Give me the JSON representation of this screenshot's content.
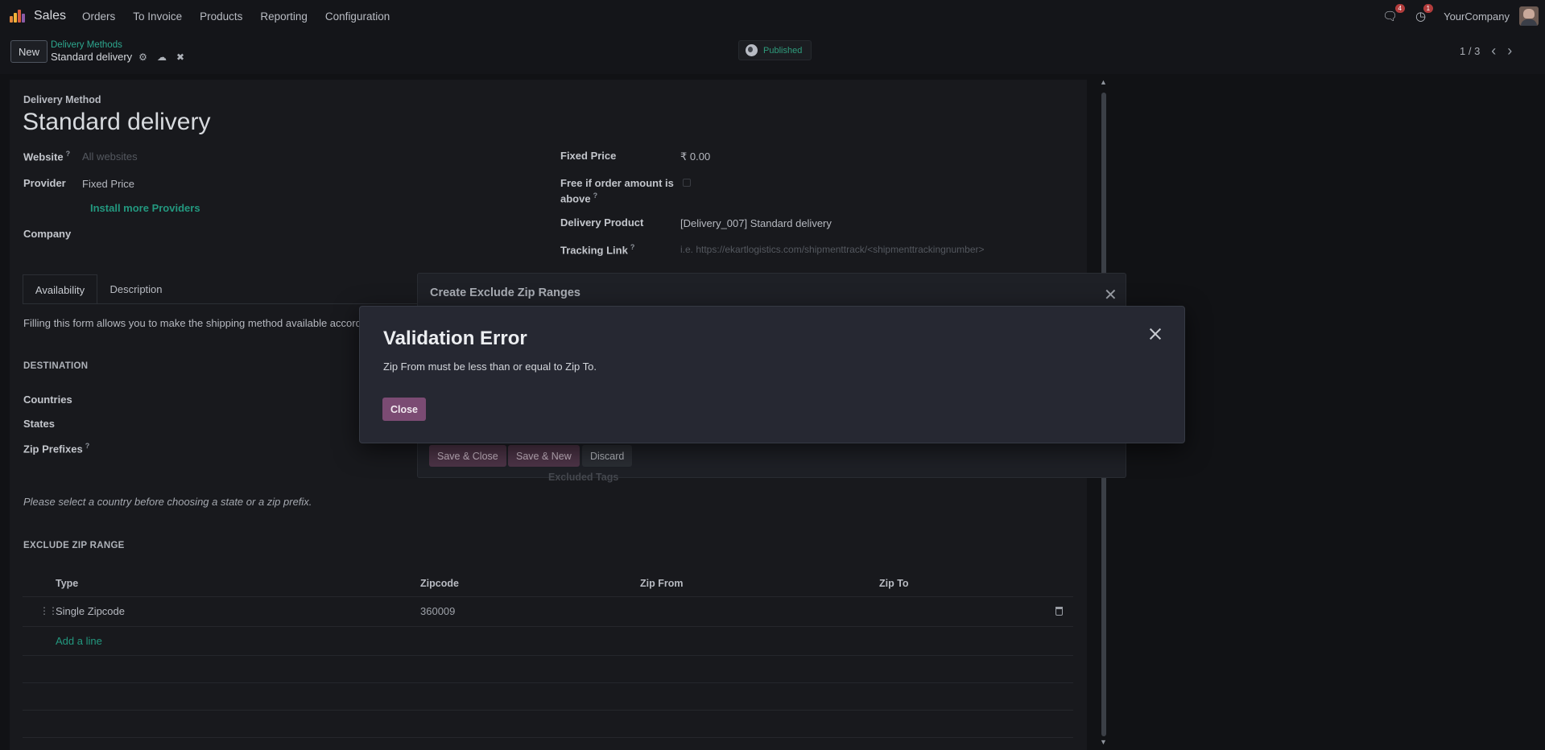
{
  "navbar": {
    "app_name": "Sales",
    "menu": [
      "Orders",
      "To Invoice",
      "Products",
      "Reporting",
      "Configuration"
    ],
    "messages_badge": "4",
    "activities_badge": "1",
    "company": "YourCompany"
  },
  "control": {
    "new_label": "New",
    "breadcrumb_parent": "Delivery Methods",
    "breadcrumb_current": "Standard delivery",
    "published_label": "Published",
    "pager": "1 / 3"
  },
  "form": {
    "header_label": "Delivery Method",
    "name": "Standard delivery",
    "website_label": "Website",
    "website_placeholder": "All websites",
    "provider_label": "Provider",
    "provider_value": "Fixed Price",
    "install_providers": "Install more Providers",
    "company_label": "Company",
    "fixed_price_label": "Fixed Price",
    "fixed_price_value": "₹ 0.00",
    "free_if_label_1": "Free if order amount is",
    "free_if_label_2": "above",
    "delivery_product_label": "Delivery Product",
    "delivery_product_value": "[Delivery_007] Standard delivery",
    "tracking_link_label": "Tracking Link",
    "tracking_link_placeholder": "i.e. https://ekartlogistics.com/shipmenttrack/<shipmenttrackingnumber>",
    "tabs": [
      "Availability",
      "Description"
    ],
    "availability_note": "Filling this form allows you to make the shipping method available accord",
    "destination_title": "DESTINATION",
    "countries_label": "Countries",
    "states_label": "States",
    "zip_prefixes_label": "Zip Prefixes",
    "country_hint": "Please select a country before choosing a state or a zip prefix.",
    "excluded_tags_label": "Excluded Tags",
    "exclude_title": "EXCLUDE ZIP RANGE",
    "table_headers": [
      "Type",
      "Zipcode",
      "Zip From",
      "Zip To"
    ],
    "rows": [
      {
        "type": "Single Zipcode",
        "zipcode": "360009",
        "zip_from": "",
        "zip_to": ""
      }
    ],
    "add_line": "Add a line"
  },
  "back_dialog": {
    "title": "Create Exclude Zip Ranges",
    "save_close": "Save & Close",
    "save_new": "Save & New",
    "discard": "Discard"
  },
  "error_dialog": {
    "title": "Validation Error",
    "message": "Zip From must be less than or equal to Zip To.",
    "close_label": "Close"
  }
}
